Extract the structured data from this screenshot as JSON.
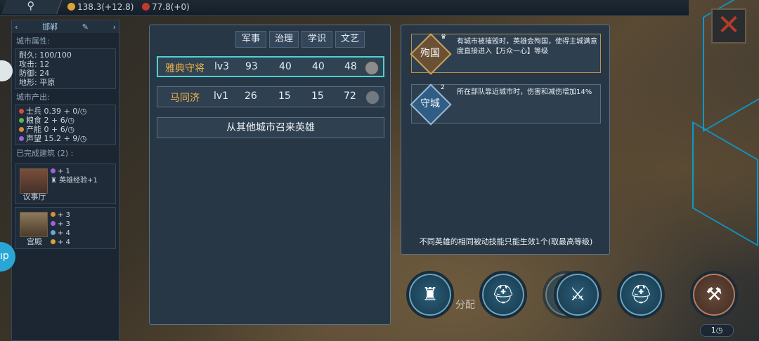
{
  "topbar": {
    "search_icon": "search-icon",
    "gold": "138.3(+12.8)",
    "food": "77.8(+0)"
  },
  "city": {
    "name": "邯郸",
    "attr_title": "城市属性:",
    "durability": "耐久: 100/100",
    "attack": "攻击: 12",
    "defense": "防御: 24",
    "terrain": "地形: 平原",
    "output_title": "城市产出:",
    "outputs": [
      {
        "label": "士兵 0.39 + 0/",
        "color": "#d94a3a"
      },
      {
        "label": "粮食 2 + 6/",
        "color": "#5fb84a"
      },
      {
        "label": "产能 0 + 6/",
        "color": "#e08a3a"
      },
      {
        "label": "声望 15.2 + 9/",
        "color": "#9b63d8"
      }
    ],
    "built_title": "已完成建筑 (2) :",
    "buildings": [
      {
        "name": "议事厅",
        "effects": [
          "+ 1",
          "英雄经验+1"
        ]
      },
      {
        "name": "宫殿",
        "effects": [
          "+ 3",
          "+ 3",
          "+ 4",
          "+ 4"
        ]
      }
    ]
  },
  "heroes": {
    "tabs": [
      "军事",
      "治理",
      "学识",
      "文艺"
    ],
    "rows": [
      {
        "name": "雅典守将",
        "level": "lv3",
        "military": "93",
        "govern": "40",
        "learning": "40",
        "arts": "48"
      },
      {
        "name": "马同济",
        "level": "lv1",
        "military": "26",
        "govern": "15",
        "learning": "15",
        "arts": "72"
      }
    ],
    "summon_label": "从其他城市召来英雄"
  },
  "skills": {
    "items": [
      {
        "badge": "殉国",
        "level": "",
        "text": "有城市被摧毁时，英雄会殉国，使得主城满意度直接进入【万众一心】等级"
      },
      {
        "badge": "守城",
        "level": "2",
        "text": "所在部队靠近城市时，伤害和减伤增加14%"
      }
    ],
    "note": "不同英雄的相同被动技能只能生效1个(取最高等级)"
  },
  "actions": {
    "count": "1",
    "faded_text": "分配"
  },
  "colors": {
    "accent": "#4fd1d3",
    "hero_name": "#f2b24a",
    "map_border": "#00a6e8"
  }
}
